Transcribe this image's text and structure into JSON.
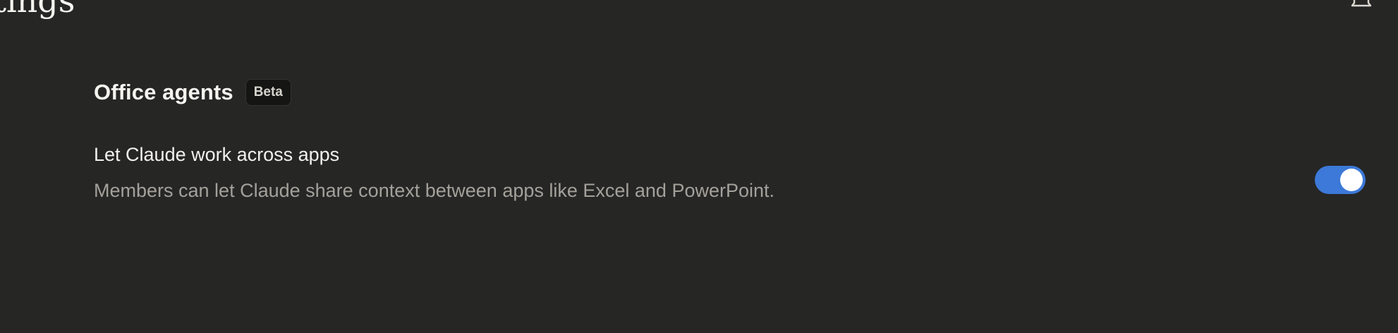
{
  "header": {
    "title": "ttings",
    "notification_icon": "bell-icon"
  },
  "section": {
    "title": "Office agents",
    "badge": "Beta",
    "setting": {
      "label": "Let Claude work across apps",
      "description": "Members can let Claude share context between apps like Excel and PowerPoint.",
      "enabled": true
    }
  },
  "colors": {
    "background": "#262625",
    "toggle_on": "#3c79d8",
    "muted_text": "#a3a19a"
  }
}
